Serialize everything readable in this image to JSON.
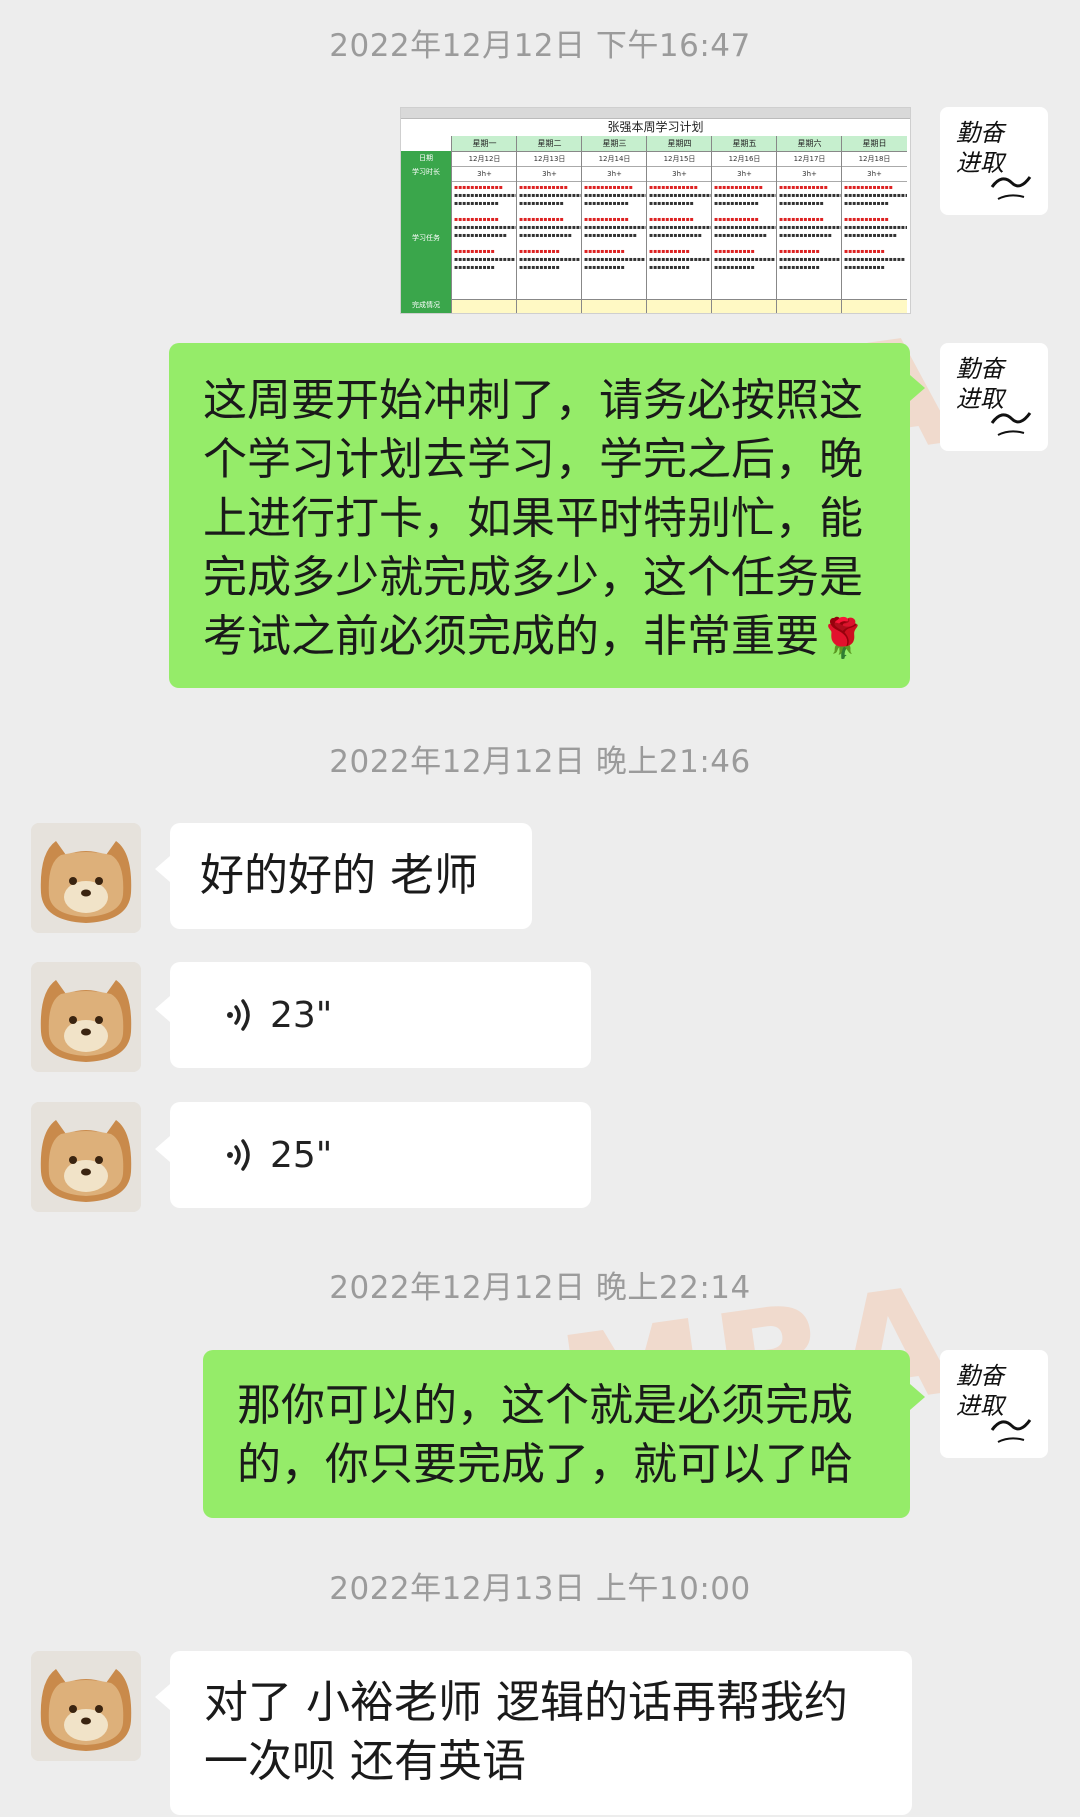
{
  "timestamps": [
    "2022年12月12日 下午16:47",
    "2022年12月12日 晚上21:46",
    "2022年12月12日 晚上22:14",
    "2022年12月13日 上午10:00"
  ],
  "teacher": {
    "avatar_text": [
      "勤奋",
      "进取"
    ]
  },
  "spreadsheet": {
    "title": "张强本周学习计划",
    "row_labels": [
      "日期",
      "学习时长",
      "学习任务",
      "完成情况"
    ],
    "days": [
      "星期一",
      "星期二",
      "星期三",
      "星期四",
      "星期五",
      "星期六",
      "星期日"
    ],
    "dates": [
      "12月12日",
      "12月13日",
      "12月14日",
      "12月15日",
      "12月16日",
      "12月17日",
      "12月18日"
    ],
    "hours": [
      "3h+",
      "3h+",
      "3h+",
      "3h+",
      "3h+",
      "3h+",
      "3h+"
    ]
  },
  "messages": {
    "teacher_1": "这周要开始冲刺了，请务必按照这个学习计划去学习，学完之后，晚上进行打卡，如果平时特别忙，能完成多少就完成多少，这个任务是考试之前必须完成的，非常重要",
    "student_1": "好的好的 老师",
    "voice_1": "23\"",
    "voice_2": "25\"",
    "teacher_2": "那你可以的，这个就是必须完成的，你只要完成了，就可以了哈",
    "student_2": "对了 小裕老师 逻辑的话再帮我约一次呗 还有英语"
  },
  "watermark": "MBA",
  "icons": {
    "rose": "rose-emoji",
    "voice": "voice-wave-icon"
  }
}
